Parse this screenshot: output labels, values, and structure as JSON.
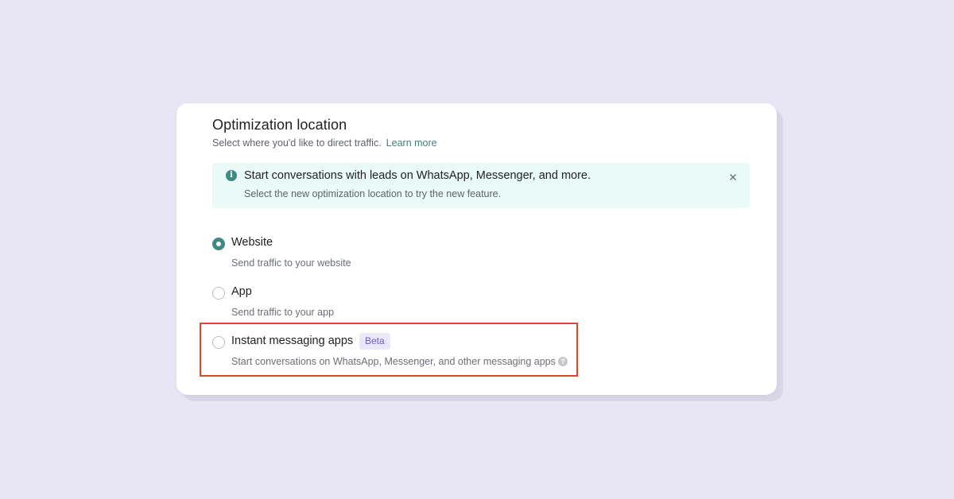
{
  "section": {
    "title": "Optimization location",
    "subtitle": "Select where you'd like to direct traffic.",
    "learn_more": "Learn more"
  },
  "banner": {
    "icon": "info-icon",
    "title": "Start conversations with leads on WhatsApp, Messenger, and more.",
    "text": "Select the new optimization location to try the new feature."
  },
  "options": [
    {
      "label": "Website",
      "description": "Send traffic to your website",
      "selected": true
    },
    {
      "label": "App",
      "description": "Send traffic to your app",
      "selected": false
    },
    {
      "label": "Instant messaging apps",
      "badge": "Beta",
      "description": "Start conversations on WhatsApp, Messenger, and other messaging apps",
      "selected": false,
      "highlighted": true
    }
  ],
  "colors": {
    "background": "#e8e6f4",
    "accent": "#3e8a83",
    "banner_bg": "#eafaf7",
    "badge_bg": "#ece8fb",
    "badge_text": "#6a5bc9",
    "highlight": "#d9472f"
  }
}
